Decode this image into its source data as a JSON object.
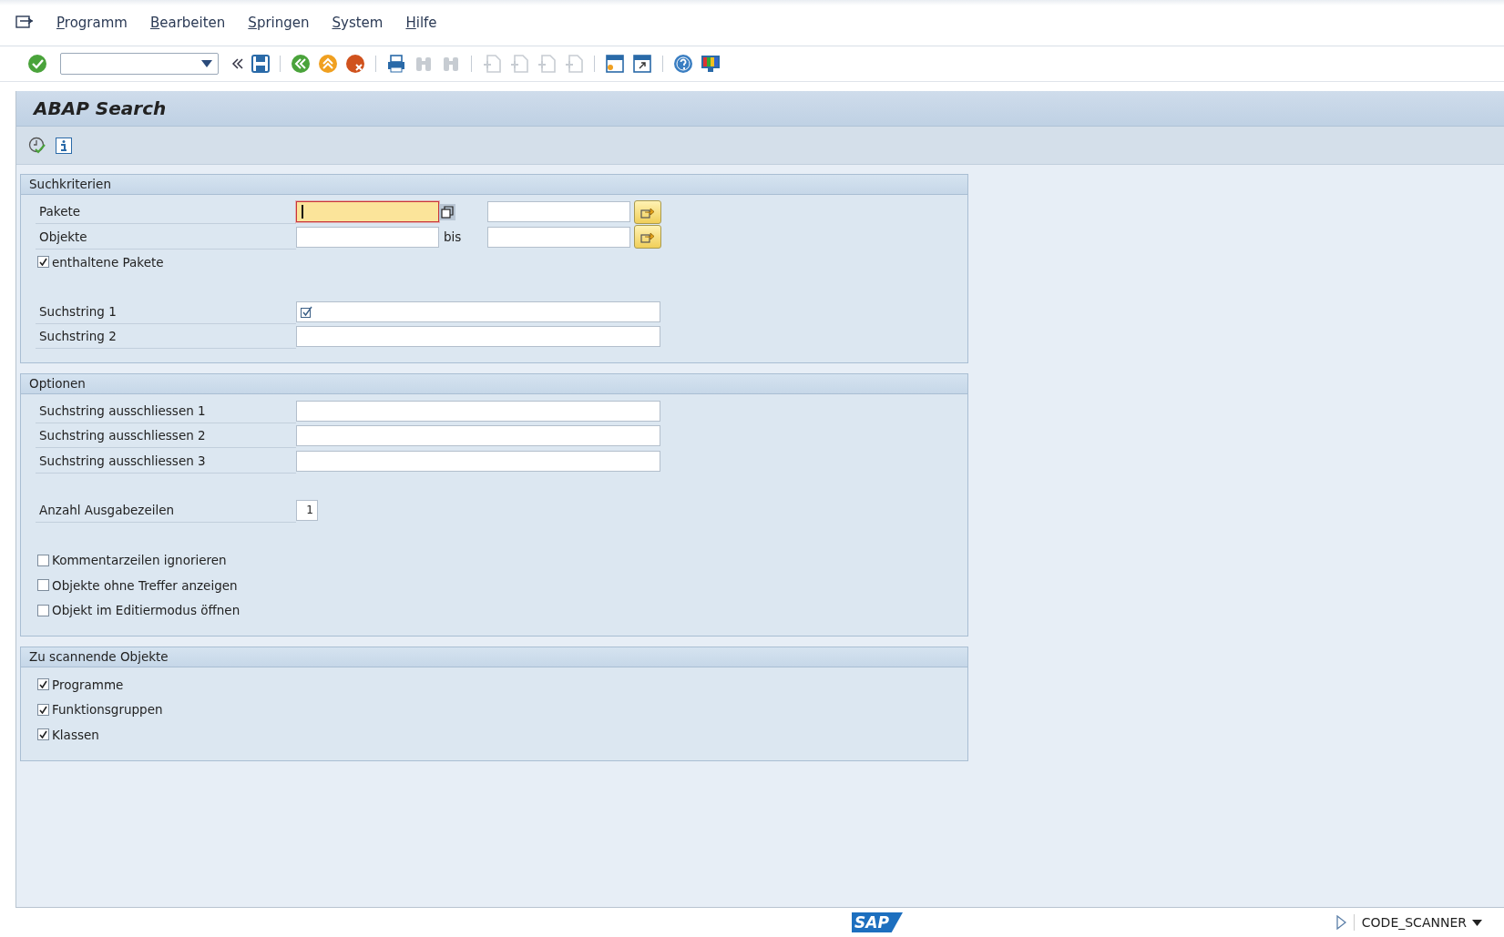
{
  "menu": [
    {
      "label": "Programm"
    },
    {
      "label": "Bearbeiten"
    },
    {
      "label": "Springen"
    },
    {
      "label": "System"
    },
    {
      "label": "Hilfe"
    }
  ],
  "title": "ABAP Search",
  "groups": [
    {
      "title": "Suchkriterien",
      "rows": [
        {
          "kind": "range",
          "label": "Pakete",
          "focused": true
        },
        {
          "kind": "range",
          "label": "Objekte",
          "to_label": "bis",
          "focused": false
        },
        {
          "kind": "checkbox",
          "label": "enthaltene Pakete",
          "checked": true
        },
        {
          "kind": "spacer"
        },
        {
          "kind": "text",
          "label": "Suchstring 1",
          "check_icon": true
        },
        {
          "kind": "text",
          "label": "Suchstring 2",
          "check_icon": false
        }
      ]
    },
    {
      "title": "Optionen",
      "rows": [
        {
          "kind": "text",
          "label": "Suchstring ausschliessen 1",
          "check_icon": false
        },
        {
          "kind": "text",
          "label": "Suchstring ausschliessen 2",
          "check_icon": false
        },
        {
          "kind": "text",
          "label": "Suchstring ausschliessen 3",
          "check_icon": false
        },
        {
          "kind": "spacer"
        },
        {
          "kind": "number",
          "label": "Anzahl Ausgabezeilen",
          "value": "1"
        },
        {
          "kind": "spacer"
        },
        {
          "kind": "checkbox",
          "label": "Kommentarzeilen ignorieren",
          "checked": false
        },
        {
          "kind": "checkbox",
          "label": "Objekte ohne Treffer anzeigen",
          "checked": false
        },
        {
          "kind": "checkbox",
          "label": "Objekt im Editiermodus öffnen",
          "checked": false
        }
      ]
    },
    {
      "title": "Zu scannende Objekte",
      "rows": [
        {
          "kind": "checkbox",
          "label": "Programme",
          "checked": true
        },
        {
          "kind": "checkbox",
          "label": "Funktionsgruppen",
          "checked": true
        },
        {
          "kind": "checkbox",
          "label": "Klassen",
          "checked": true
        }
      ]
    }
  ],
  "status_bar": {
    "logo": "SAP",
    "system": "CODE_SCANNER"
  }
}
